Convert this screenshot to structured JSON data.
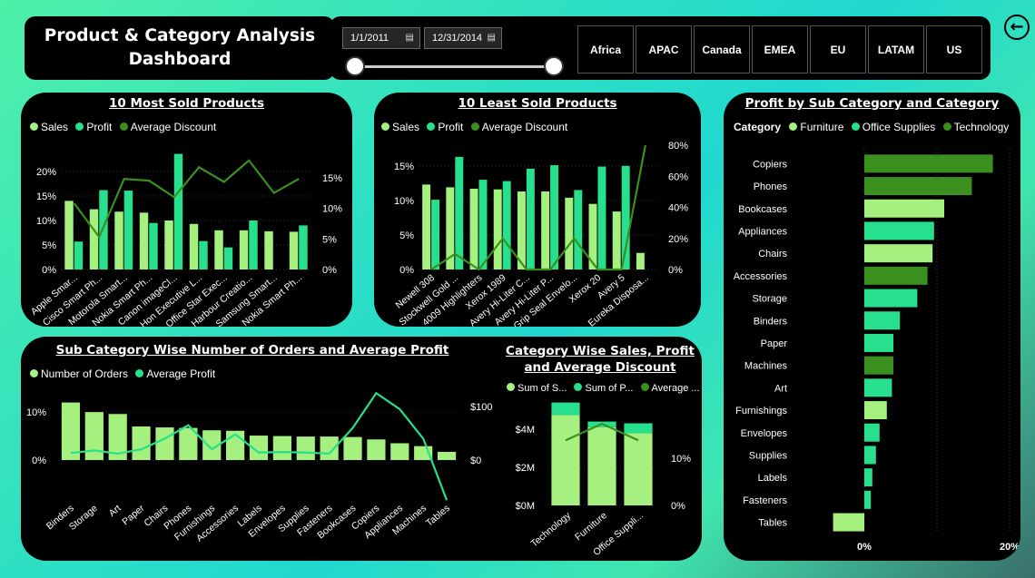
{
  "header": {
    "title_line1": "Product & Category Analysis",
    "title_line2": "Dashboard"
  },
  "filters": {
    "start_date": "1/1/2011",
    "end_date": "12/31/2014",
    "calendar_icon": "calendar-icon",
    "regions": [
      "Africa",
      "APAC",
      "Canada",
      "EMEA",
      "EU",
      "LATAM",
      "US"
    ]
  },
  "nav": {
    "back_icon": "back-arrow-icon"
  },
  "colors": {
    "sales": "#a5f07f",
    "profit": "#27e08d",
    "discount": "#3b8f1e",
    "furniture": "#a5f07f",
    "office_supplies": "#27e08d",
    "technology": "#3b8f1e",
    "panel_bg": "#000000"
  },
  "most_sold": {
    "title": "10 Most Sold Products",
    "legend": [
      "Sales",
      "Profit",
      "Average Discount"
    ]
  },
  "least_sold": {
    "title": "10 Least Sold Products",
    "legend": [
      "Sales",
      "Profit",
      "Average Discount"
    ]
  },
  "subcat_bar": {
    "title": "Profit by Sub Category and Category",
    "legend_title": "Category",
    "legend": [
      "Furniture",
      "Office Supplies",
      "Technology"
    ]
  },
  "subcat_orders": {
    "title": "Sub Category Wise Number of Orders and Average Profit",
    "legend": [
      "Number of Orders",
      "Average Profit"
    ]
  },
  "category_sales": {
    "title_line1": "Category Wise Sales, Profit",
    "title_line2": "and Average Discount",
    "legend": [
      "Sum of S...",
      "Sum of P...",
      "Average ..."
    ]
  },
  "chart_data": [
    {
      "id": "most_sold",
      "type": "bar",
      "title": "10 Most Sold Products",
      "categories": [
        "Apple Smar...",
        "Cisco Smart Ph...",
        "Motorola Smart...",
        "Nokia Smart Ph...",
        "Canon imageCl...",
        "Hon Executive L...",
        "Office Star Exec...",
        "Harbour Creatio...",
        "Samsung Smart...",
        "Nokia Smart Ph..."
      ],
      "series": [
        {
          "name": "Sales",
          "values": [
            14,
            12.3,
            11.8,
            11.6,
            10,
            9.3,
            8,
            8,
            7.8,
            7.7
          ]
        },
        {
          "name": "Profit",
          "values": [
            5.7,
            16.2,
            16.1,
            9.5,
            23.6,
            5.8,
            4.5,
            10,
            0,
            9
          ]
        },
        {
          "name": "Average Discount",
          "axis": "right",
          "values": [
            10.8,
            5.3,
            14.8,
            14.5,
            11.8,
            16.7,
            14.3,
            17.8,
            12.5,
            14.8
          ]
        }
      ],
      "ylim": [
        0,
        25
      ],
      "y_ticks": [
        "0%",
        "5%",
        "10%",
        "15%",
        "20%"
      ],
      "y2lim": [
        0,
        20
      ],
      "y2_ticks": [
        "0%",
        "5%",
        "10%",
        "15%"
      ]
    },
    {
      "id": "least_sold",
      "type": "bar",
      "title": "10 Least Sold Products",
      "categories": [
        "Newell 308",
        "Stockwell Gold ...",
        "4009 Highlighters",
        "Xerox 1989",
        "Avery Hi-Liter C...",
        "Avery Hi-Liter P...",
        "Grip Seal Envelo...",
        "Xerox 20",
        "Avery 5",
        "Eureka Disposa..."
      ],
      "series": [
        {
          "name": "Sales",
          "values": [
            12.3,
            11.9,
            11.7,
            11.6,
            11.3,
            11.3,
            10.4,
            9.5,
            8.4,
            2.4
          ]
        },
        {
          "name": "Profit",
          "values": [
            10.1,
            16.3,
            13,
            12.8,
            14.6,
            15.1,
            11.5,
            14.9,
            15,
            0
          ]
        },
        {
          "name": "Average Discount",
          "axis": "right",
          "values": [
            0,
            10,
            0,
            20,
            0,
            0,
            20,
            0,
            0,
            80
          ]
        }
      ],
      "ylim": [
        0,
        18
      ],
      "y_ticks": [
        "0%",
        "5%",
        "10%",
        "15%"
      ],
      "y2lim": [
        0,
        80
      ],
      "y2_ticks": [
        "0%",
        "20%",
        "40%",
        "60%",
        "80%"
      ]
    },
    {
      "id": "profit_by_subcategory",
      "type": "bar",
      "orientation": "horizontal",
      "title": "Profit by Sub Category and Category",
      "categories": [
        "Copiers",
        "Phones",
        "Bookcases",
        "Appliances",
        "Chairs",
        "Accessories",
        "Storage",
        "Binders",
        "Paper",
        "Machines",
        "Art",
        "Furnishings",
        "Envelopes",
        "Supplies",
        "Labels",
        "Fasteners",
        "Tables"
      ],
      "category_group": [
        "Technology",
        "Technology",
        "Furniture",
        "Office Supplies",
        "Furniture",
        "Technology",
        "Office Supplies",
        "Office Supplies",
        "Office Supplies",
        "Technology",
        "Office Supplies",
        "Furniture",
        "Office Supplies",
        "Office Supplies",
        "Office Supplies",
        "Office Supplies",
        "Furniture"
      ],
      "values": [
        17.7,
        14.8,
        11,
        9.6,
        9.4,
        8.7,
        7.3,
        4.9,
        4,
        4,
        3.8,
        3.1,
        2.1,
        1.6,
        1.1,
        0.9,
        -4.3
      ],
      "x_ticks": [
        "0%",
        "20%"
      ],
      "xlim": [
        -5,
        20
      ]
    },
    {
      "id": "subcat_orders",
      "type": "bar",
      "title": "Sub Category Wise Number of Orders and Average Profit",
      "categories": [
        "Binders",
        "Storage",
        "Art",
        "Paper",
        "Chairs",
        "Phones",
        "Furnishings",
        "Accessories",
        "Labels",
        "Envelopes",
        "Supplies",
        "Fasteners",
        "Bookcases",
        "Copiers",
        "Appliances",
        "Machines",
        "Tables"
      ],
      "series": [
        {
          "name": "Number of Orders",
          "values": [
            12,
            10,
            9.6,
            7,
            6.8,
            6.7,
            6.2,
            6.1,
            5.1,
            5,
            4.9,
            4.9,
            4.8,
            4.3,
            3.5,
            2.9,
            1.7
          ]
        },
        {
          "name": "Average Profit",
          "axis": "right",
          "values": [
            13,
            18,
            12,
            20,
            40,
            65,
            20,
            48,
            14,
            15,
            14,
            12,
            60,
            125,
            95,
            40,
            -75
          ]
        }
      ],
      "ylim": [
        0,
        14
      ],
      "y_ticks": [
        "0%",
        "10%"
      ],
      "y2lim": [
        -100,
        120
      ],
      "y2_ticks": [
        "$0",
        "$100"
      ]
    },
    {
      "id": "category_sales",
      "type": "bar",
      "stacked": true,
      "title": "Category Wise Sales, Profit and Average Discount",
      "categories": [
        "Technology",
        "Furniture",
        "Office Suppli..."
      ],
      "series": [
        {
          "name": "Sum of Sales",
          "values": [
            4.74,
            4.11,
            3.79
          ]
        },
        {
          "name": "Sum of Profit",
          "values": [
            0.66,
            0.29,
            0.52
          ]
        },
        {
          "name": "Average Discount",
          "axis": "right",
          "values": [
            13.8,
            17.3,
            13.8
          ]
        }
      ],
      "ylim": [
        0,
        6
      ],
      "y_ticks": [
        "$0M",
        "$2M",
        "$4M"
      ],
      "y2lim": [
        0,
        20
      ],
      "y2_ticks": [
        "0%",
        "10%"
      ]
    }
  ]
}
